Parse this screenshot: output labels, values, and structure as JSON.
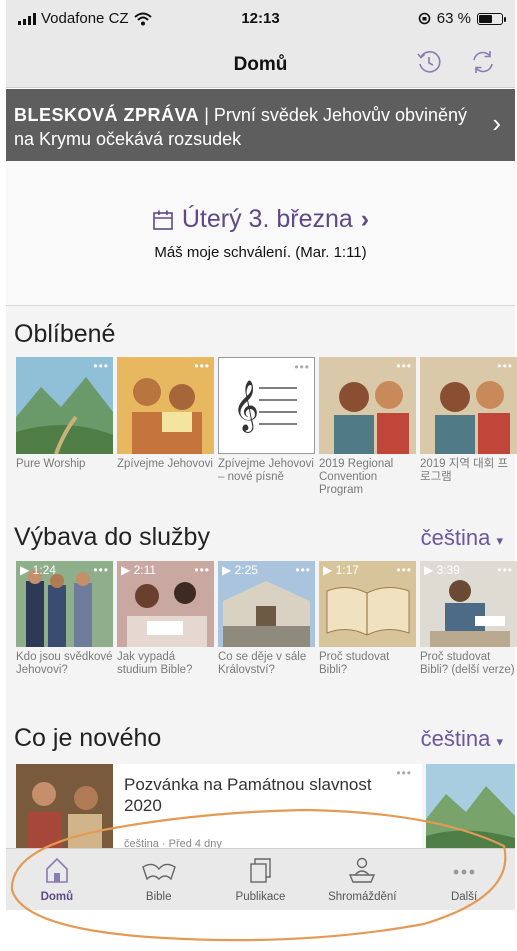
{
  "status_bar": {
    "carrier": "Vodafone CZ",
    "time": "12:13",
    "battery": "63 %",
    "battery_level": 0.63
  },
  "nav": {
    "title": "Domů"
  },
  "breaking": {
    "label": "BLESKOVÁ ZPRÁVA",
    "separator": "|",
    "text": "První svědek Jehovův obviněný na Krymu očekává rozsudek"
  },
  "daily": {
    "date": "Úterý 3. března",
    "chevron": "›",
    "scripture": "Máš moje schválení. (Mar. 1:11)"
  },
  "favorites": {
    "title": "Oblíbené",
    "items": [
      {
        "caption": "Pure Worship"
      },
      {
        "caption": "Zpívejme Jehovovi"
      },
      {
        "caption": "Zpívejme Jehovovi – nové písně"
      },
      {
        "caption": "2019 Regional Convention Program"
      },
      {
        "caption": "2019 지역 대회 프로그램"
      }
    ]
  },
  "ministry": {
    "title": "Výbava do služby",
    "language": "čeština",
    "items": [
      {
        "duration": "1:24",
        "caption": "Kdo jsou svědkové Jehovovi?"
      },
      {
        "duration": "2:11",
        "caption": "Jak vypadá studium Bible?"
      },
      {
        "duration": "2:25",
        "caption": "Co se děje v sále Království?"
      },
      {
        "duration": "1:17",
        "caption": "Proč studovat Bibli?"
      },
      {
        "duration": "3:39",
        "caption": "Proč studovat Bibli? (delší verze)"
      }
    ]
  },
  "whats_new": {
    "title": "Co je nového",
    "language": "čeština",
    "card": {
      "title": "Pozvánka na Památnou slavnost 2020",
      "meta": "čeština · Před 4 dny"
    }
  },
  "tabbar": {
    "tabs": [
      {
        "label": "Domů",
        "icon": "home-icon",
        "active": true
      },
      {
        "label": "Bible",
        "icon": "bible-icon"
      },
      {
        "label": "Publikace",
        "icon": "publications-icon"
      },
      {
        "label": "Shromáždění",
        "icon": "meetings-icon"
      },
      {
        "label": "Další",
        "icon": "more-icon"
      }
    ]
  },
  "colors": {
    "accent": "#5d4a86",
    "banner": "#5e5e5e",
    "annotation": "#e39a55"
  }
}
